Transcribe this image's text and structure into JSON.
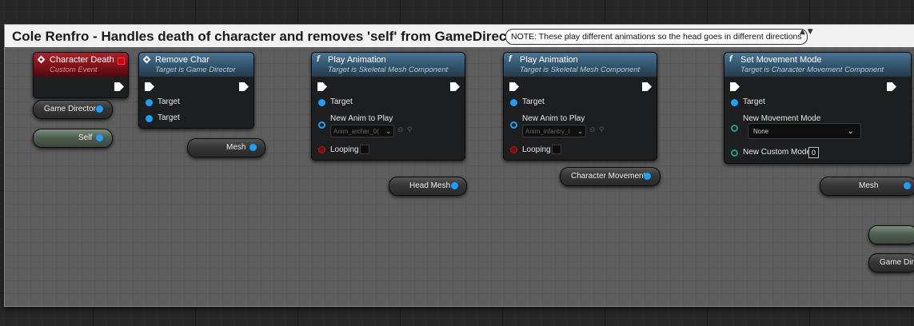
{
  "comment": {
    "title": "Cole Renfro - Handles death of character and removes 'self' from GameDirector",
    "note": "NOTE: These play different animations so the head goes in different directions",
    "note_toggle": "▲ ▼"
  },
  "nodes": {
    "character_death": {
      "title": "Character Death",
      "subtitle": "Custom Event"
    },
    "remove_char": {
      "title": "Remove Char",
      "subtitle": "Target is Game Director",
      "pin1": "Target",
      "pin2": "Target"
    },
    "play_anim_1": {
      "icon": "f",
      "title": "Play Animation",
      "subtitle": "Target is Skeletal Mesh Component",
      "target": "Target",
      "anim_label": "New Anim to Play",
      "anim_value": "Anim_archer_0(",
      "looping": "Looping"
    },
    "play_anim_2": {
      "icon": "f",
      "title": "Play Animation",
      "subtitle": "Target is Skeletal Mesh Component",
      "target": "Target",
      "anim_label": "New Anim to Play",
      "anim_value": "Anim_infantry_I",
      "looping": "Looping"
    },
    "set_movement": {
      "icon": "f",
      "title": "Set Movement Mode",
      "subtitle": "Target is Character Movement Component",
      "target": "Target",
      "mode_label": "New Movement Mode",
      "mode_value": "None",
      "custom_label": "New Custom Mode",
      "custom_value": "0"
    }
  },
  "variables": {
    "game_director": "Game Director",
    "self": "Self",
    "mesh": "Mesh",
    "head_mesh": "Head Mesh",
    "character_movement": "Character Movement",
    "mesh_2": "Mesh",
    "game_director_2": "Game Direc"
  },
  "icons": {
    "function": "f",
    "dropdown": "⌄",
    "browse": "⊖",
    "search": "⚲"
  },
  "colors": {
    "object_pin": "#1aa1ff",
    "event_header": "#a8222c",
    "function_header": "#4a7695",
    "comment_title_bg": "#f2f2f2"
  }
}
